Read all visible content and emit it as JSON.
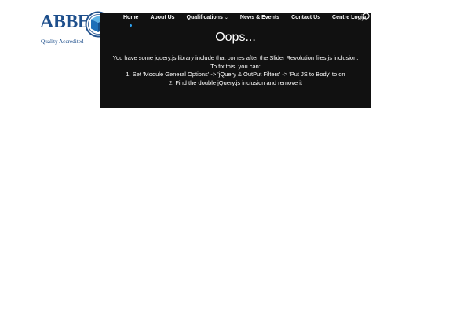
{
  "logo": {
    "name": "ABBE",
    "tagline": "Quality Accredited"
  },
  "nav": {
    "items": [
      {
        "label": "Home",
        "active": true
      },
      {
        "label": "About Us"
      },
      {
        "label": "Qualifications",
        "has_dropdown": true
      },
      {
        "label": "News & Events"
      },
      {
        "label": "Contact Us"
      },
      {
        "label": "Centre Login"
      }
    ],
    "search_icon": "search-icon",
    "dropdown_icon": "chevron-down-icon",
    "active_indicator_color": "#2ea3f2"
  },
  "error": {
    "title": "Oops...",
    "lines": [
      "You have some jquery.js library include that comes after the Slider Revolution files js inclusion.",
      "To fix this, you can:",
      "1. Set 'Module General Options' -> 'jQuery & OutPut Filters' -> 'Put JS to Body' to on",
      "2. Find the double jQuery.js inclusion and remove it"
    ]
  },
  "colors": {
    "brand_blue": "#1e4f8c",
    "panel_bg": "#111111",
    "text_light": "#ffffff"
  }
}
